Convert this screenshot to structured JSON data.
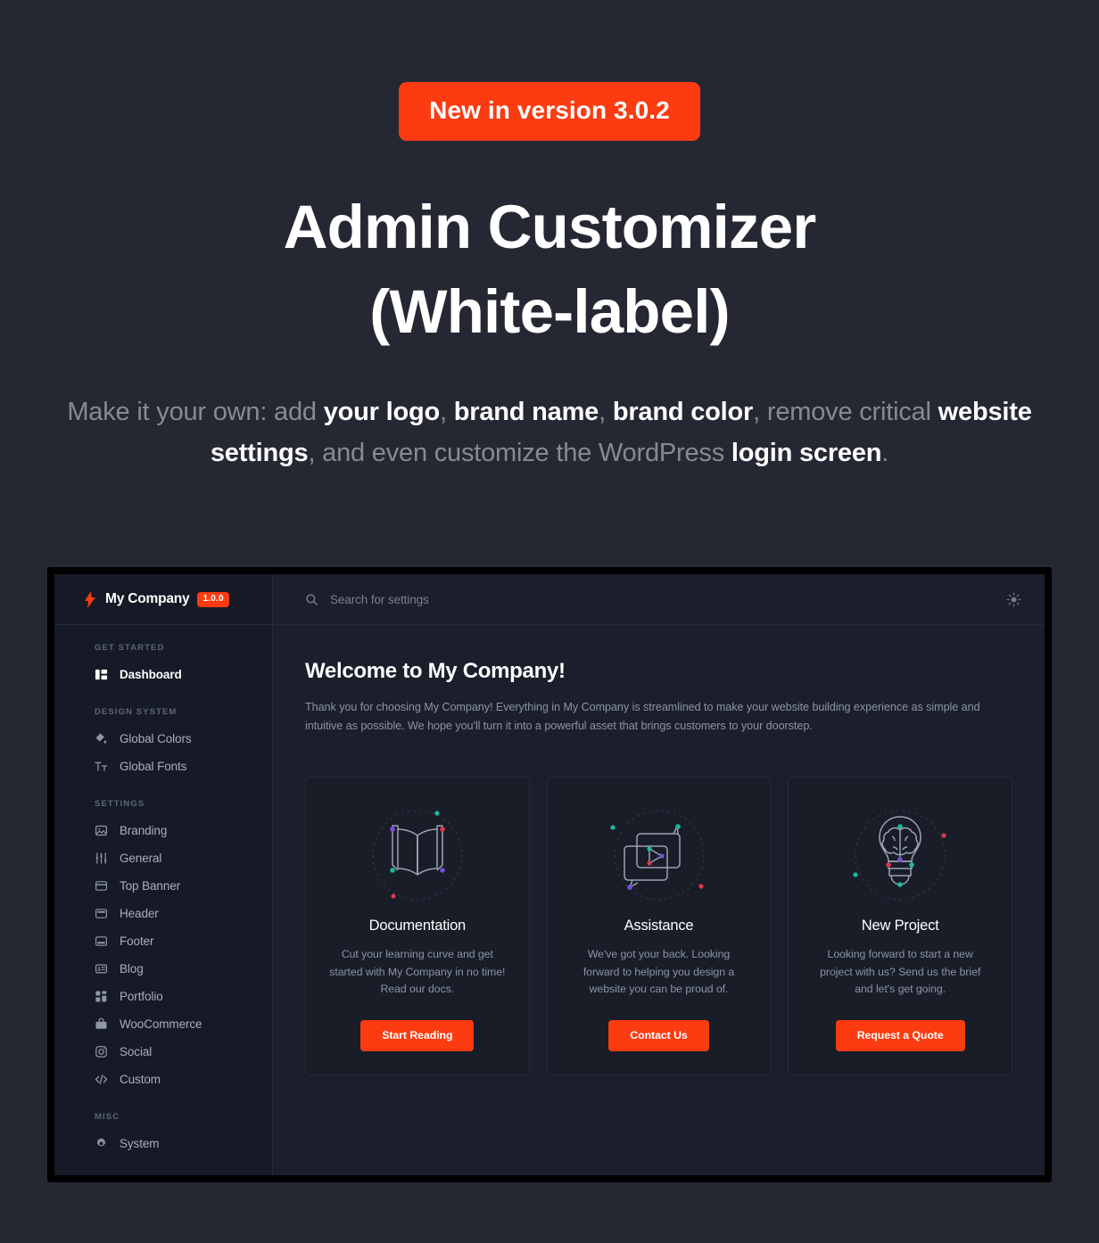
{
  "hero": {
    "badge": "New in version 3.0.2",
    "title_line1": "Admin Customizer",
    "title_line2": "(White-label)",
    "sub_1": "Make it your own: add ",
    "sub_b1": "your logo",
    "sub_2": ", ",
    "sub_b2": "brand name",
    "sub_3": ", ",
    "sub_b3": "brand color",
    "sub_4": ", remove critical ",
    "sub_b4": "website settings",
    "sub_5": ", and even customize the WordPress ",
    "sub_b5": "login screen",
    "sub_6": "."
  },
  "colors": {
    "page_bg": "#252833",
    "accent": "#fc3b11",
    "sidebar_bg": "#151a26",
    "app_bg": "#1b1f2b",
    "card_bg": "#181d28",
    "frame": "#000000",
    "muted_text": "#8b93a5",
    "dot_purple": "#7b4ddb",
    "dot_red": "#d93a4e",
    "dot_teal": "#1bb9a0"
  },
  "app": {
    "brand": {
      "logo_icon": "lightning-bolt-icon",
      "name": "My Company",
      "version": "1.0.0"
    },
    "search": {
      "icon": "search-icon",
      "placeholder": "Search for settings"
    },
    "theme_toggle_icon": "sun-icon",
    "sidebar": {
      "sections": [
        {
          "label": "GET STARTED",
          "items": [
            {
              "label": "Dashboard",
              "icon": "dashboard-layout-icon",
              "active": true
            }
          ]
        },
        {
          "label": "DESIGN SYSTEM",
          "items": [
            {
              "label": "Global Colors",
              "icon": "paint-bucket-icon",
              "active": false
            },
            {
              "label": "Global Fonts",
              "icon": "typography-icon",
              "active": false
            }
          ]
        },
        {
          "label": "SETTINGS",
          "items": [
            {
              "label": "Branding",
              "icon": "image-icon",
              "active": false
            },
            {
              "label": "General",
              "icon": "sliders-icon",
              "active": false
            },
            {
              "label": "Top Banner",
              "icon": "top-banner-icon",
              "active": false
            },
            {
              "label": "Header",
              "icon": "header-layout-icon",
              "active": false
            },
            {
              "label": "Footer",
              "icon": "footer-layout-icon",
              "active": false
            },
            {
              "label": "Blog",
              "icon": "blog-post-icon",
              "active": false
            },
            {
              "label": "Portfolio",
              "icon": "portfolio-grid-icon",
              "active": false
            },
            {
              "label": "WooCommerce",
              "icon": "shopping-bag-icon",
              "active": false
            },
            {
              "label": "Social",
              "icon": "instagram-icon",
              "active": false
            },
            {
              "label": "Custom",
              "icon": "code-icon",
              "active": false
            }
          ]
        },
        {
          "label": "MISC",
          "items": [
            {
              "label": "System",
              "icon": "gear-icon",
              "active": false
            }
          ]
        }
      ]
    },
    "welcome": {
      "title": "Welcome to My Company!",
      "body": "Thank you for choosing My Company! Everything in My Company is streamlined to make your website building experience as simple and intuitive as possible. We hope you'll turn it into a powerful asset that brings customers to your doorstep."
    },
    "cards": [
      {
        "illo": "open-book-illustration",
        "title": "Documentation",
        "text": "Cut your learning curve and get started with My Company in no time! Read our docs.",
        "button": "Start Reading"
      },
      {
        "illo": "chat-bubbles-illustration",
        "title": "Assistance",
        "text": "We've got your back. Looking forward to helping you design a website you can be proud of.",
        "button": "Contact Us"
      },
      {
        "illo": "lightbulb-brain-illustration",
        "title": "New Project",
        "text": "Looking forward to start a new project with us? Send us the brief and let's get going.",
        "button": "Request a Quote"
      }
    ]
  }
}
